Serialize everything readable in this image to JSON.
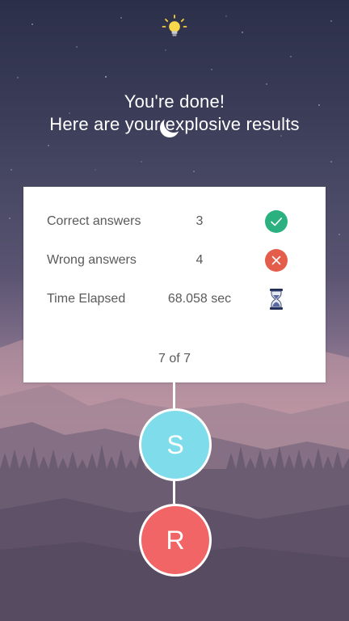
{
  "header": {
    "title_line1": "You're done!",
    "title_line2": "Here are your explosive results",
    "bulb_icon": "lightbulb-icon"
  },
  "results": {
    "rows": [
      {
        "label": "Correct answers",
        "value": "3",
        "icon": "check-icon",
        "color": "#2bb07f"
      },
      {
        "label": "Wrong answers",
        "value": "4",
        "icon": "close-icon",
        "color": "#e45c4a"
      },
      {
        "label": "Time Elapsed",
        "value": "68.058 sec",
        "icon": "hourglass-icon",
        "color": "#3b4a7a"
      }
    ],
    "counter": "7 of 7"
  },
  "buttons": {
    "share_label": "S",
    "share_color": "#7fdcea",
    "restart_label": "R",
    "restart_color": "#f26566"
  }
}
